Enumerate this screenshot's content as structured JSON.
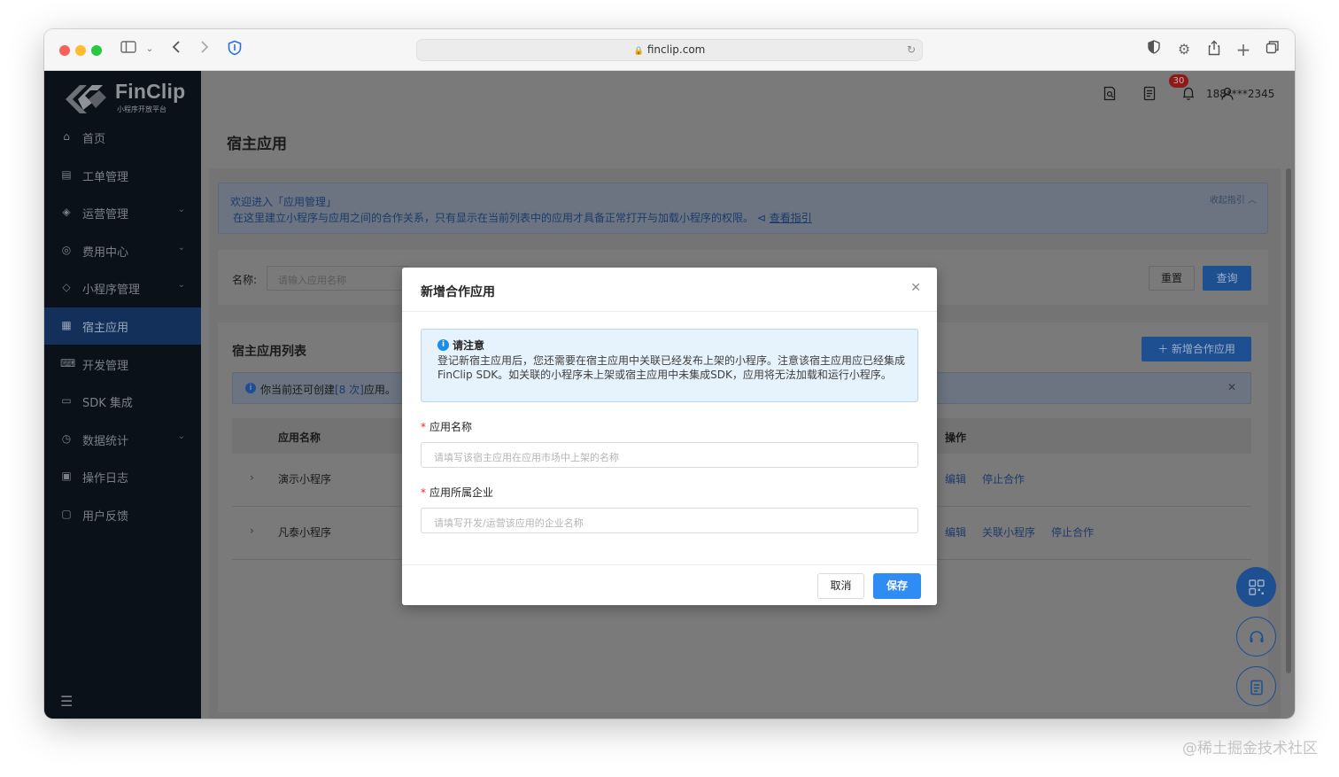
{
  "browser": {
    "url": "finclip.com"
  },
  "logo": {
    "name": "FinClip",
    "subtitle": "小程序开放平台"
  },
  "sidebar": {
    "items": [
      {
        "label": "首页",
        "icon": "home-icon",
        "glyph": "⌂",
        "expandable": false,
        "active": false
      },
      {
        "label": "工单管理",
        "icon": "ticket-icon",
        "glyph": "▤",
        "expandable": false,
        "active": false
      },
      {
        "label": "运营管理",
        "icon": "layers-icon",
        "glyph": "◈",
        "expandable": true,
        "active": false
      },
      {
        "label": "费用中心",
        "icon": "coin-icon",
        "glyph": "◎",
        "expandable": true,
        "active": false
      },
      {
        "label": "小程序管理",
        "icon": "diamond-icon",
        "glyph": "◇",
        "expandable": true,
        "active": false
      },
      {
        "label": "宿主应用",
        "icon": "apps-icon",
        "glyph": "▦",
        "expandable": false,
        "active": true
      },
      {
        "label": "开发管理",
        "icon": "code-icon",
        "glyph": "⌨",
        "expandable": false,
        "active": false
      },
      {
        "label": "SDK 集成",
        "icon": "sdk-icon",
        "glyph": "▭",
        "expandable": false,
        "active": false
      },
      {
        "label": "数据统计",
        "icon": "chart-icon",
        "glyph": "◷",
        "expandable": true,
        "active": false
      },
      {
        "label": "操作日志",
        "icon": "log-icon",
        "glyph": "▣",
        "expandable": false,
        "active": false
      },
      {
        "label": "用户反馈",
        "icon": "feedback-icon",
        "glyph": "▢",
        "expandable": false,
        "active": false
      }
    ]
  },
  "topbar": {
    "notification_count": "30",
    "user_phone": "188****2345"
  },
  "page": {
    "title": "宿主应用"
  },
  "banner": {
    "line1": "欢迎进入「应用管理」",
    "line2": "在这里建立小程序与应用之间的合作关系，只有显示在当前列表中的应用才具备正常打开与加载小程序的权限。",
    "link": "查看指引",
    "collapse": "收起指引 ︿"
  },
  "search": {
    "label": "名称:",
    "placeholder": "请输入应用名称",
    "reset": "重置",
    "query": "查询"
  },
  "list": {
    "title": "宿主应用列表",
    "add_button": "＋ 新增合作应用",
    "notice_prefix": "你当前还可创建",
    "notice_highlight": "[8 次]",
    "notice_suffix": "应用。",
    "col_name": "应用名称",
    "col_ops": "操作",
    "rows": [
      {
        "name": "演示小程序",
        "ops": [
          "编辑",
          "停止合作"
        ]
      },
      {
        "name": "凡泰小程序",
        "ops": [
          "编辑",
          "关联小程序",
          "停止合作"
        ]
      }
    ]
  },
  "modal": {
    "title": "新增合作应用",
    "alert_title": "请注意",
    "alert_body": "登记新宿主应用后，您还需要在宿主应用中关联已经发布上架的小程序。注意该宿主应用应已经集成FinClip SDK。如关联的小程序未上架或宿主应用中未集成SDK，应用将无法加载和运行小程序。",
    "field1_label": "应用名称",
    "field1_placeholder": "请填写该宿主应用在应用市场中上架的名称",
    "field2_label": "应用所属企业",
    "field2_placeholder": "请填写开发/运营该应用的企业名称",
    "cancel": "取消",
    "save": "保存"
  },
  "watermark": "@稀土掘金技术社区",
  "colors": {
    "primary": "#2f8cf5",
    "sidebar_bg": "#0a1119",
    "sidebar_active": "#12305a",
    "required": "#f5222d"
  }
}
